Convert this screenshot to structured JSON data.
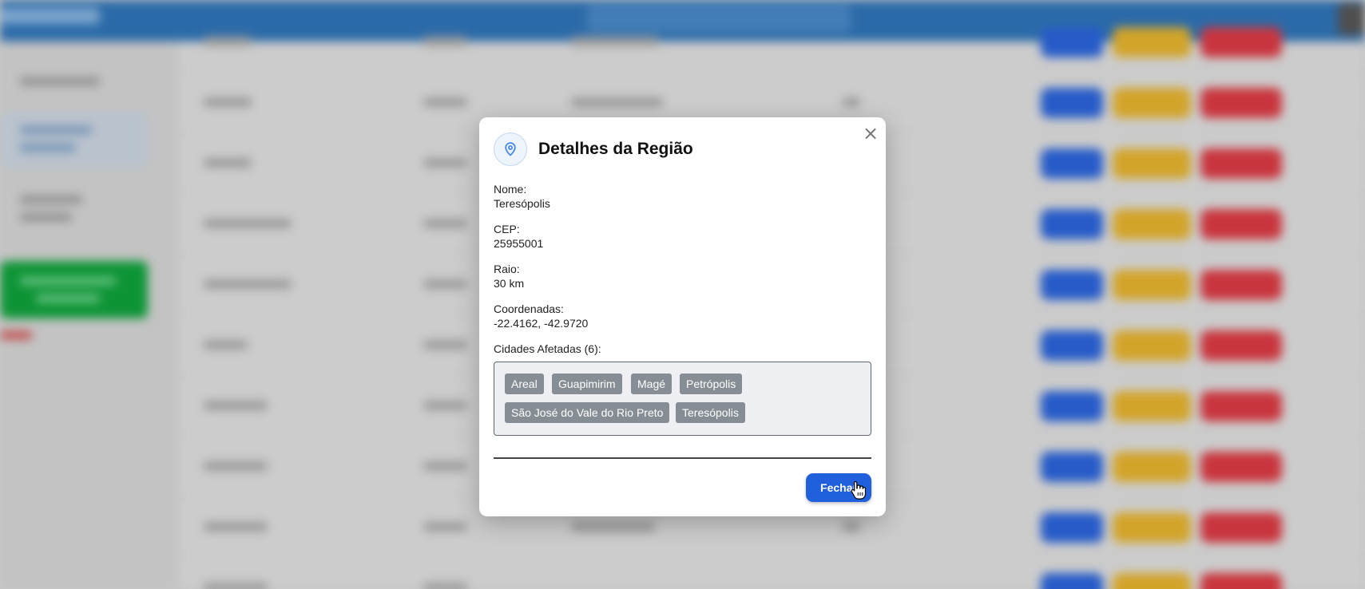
{
  "modal": {
    "title": "Detalhes da Região",
    "close_symbol": "×",
    "icon": "location-pin-icon",
    "fields": [
      {
        "label": "Nome:",
        "value": "Teresópolis"
      },
      {
        "label": "CEP:",
        "value": "25955001"
      },
      {
        "label": "Raio:",
        "value": "30 km"
      },
      {
        "label": "Coordenadas:",
        "value": "-22.4162, -42.9720"
      }
    ],
    "cities_label": "Cidades Afetadas (6):",
    "cities": [
      "Areal",
      "Guapimirim",
      "Magé",
      "Petrópolis",
      "São José do Vale do Rio Preto",
      "Teresópolis"
    ],
    "close_button": "Fechar"
  },
  "colors": {
    "header_blue": "#2f73b5",
    "primary_button": "#2060dd",
    "chip_bg": "#868d95",
    "view_button": "#2a63d8",
    "edit_button": "#e2b12e",
    "delete_button": "#d93a43",
    "sidebar_green": "#0fa03a"
  }
}
